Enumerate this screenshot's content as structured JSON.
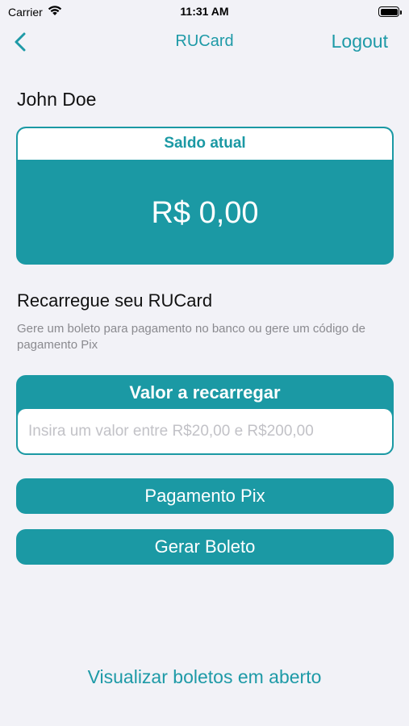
{
  "status_bar": {
    "carrier": "Carrier",
    "time": "11:31 AM"
  },
  "nav": {
    "title": "RUCard",
    "logout_label": "Logout"
  },
  "user": {
    "name": "John Doe"
  },
  "balance": {
    "header": "Saldo atual",
    "value": "R$ 0,00"
  },
  "recharge": {
    "title": "Recarregue seu RUCard",
    "description": "Gere um boleto para pagamento no banco ou gere um código de pagamento Pix",
    "amount_header": "Valor a recarregar",
    "amount_placeholder": "Insira um valor entre R$20,00 e R$200,00",
    "pix_label": "Pagamento Pix",
    "boleto_label": "Gerar Boleto"
  },
  "footer": {
    "open_boletos_label": "Visualizar boletos em aberto"
  },
  "colors": {
    "accent": "#1b99a4",
    "background": "#f2f2f7"
  }
}
